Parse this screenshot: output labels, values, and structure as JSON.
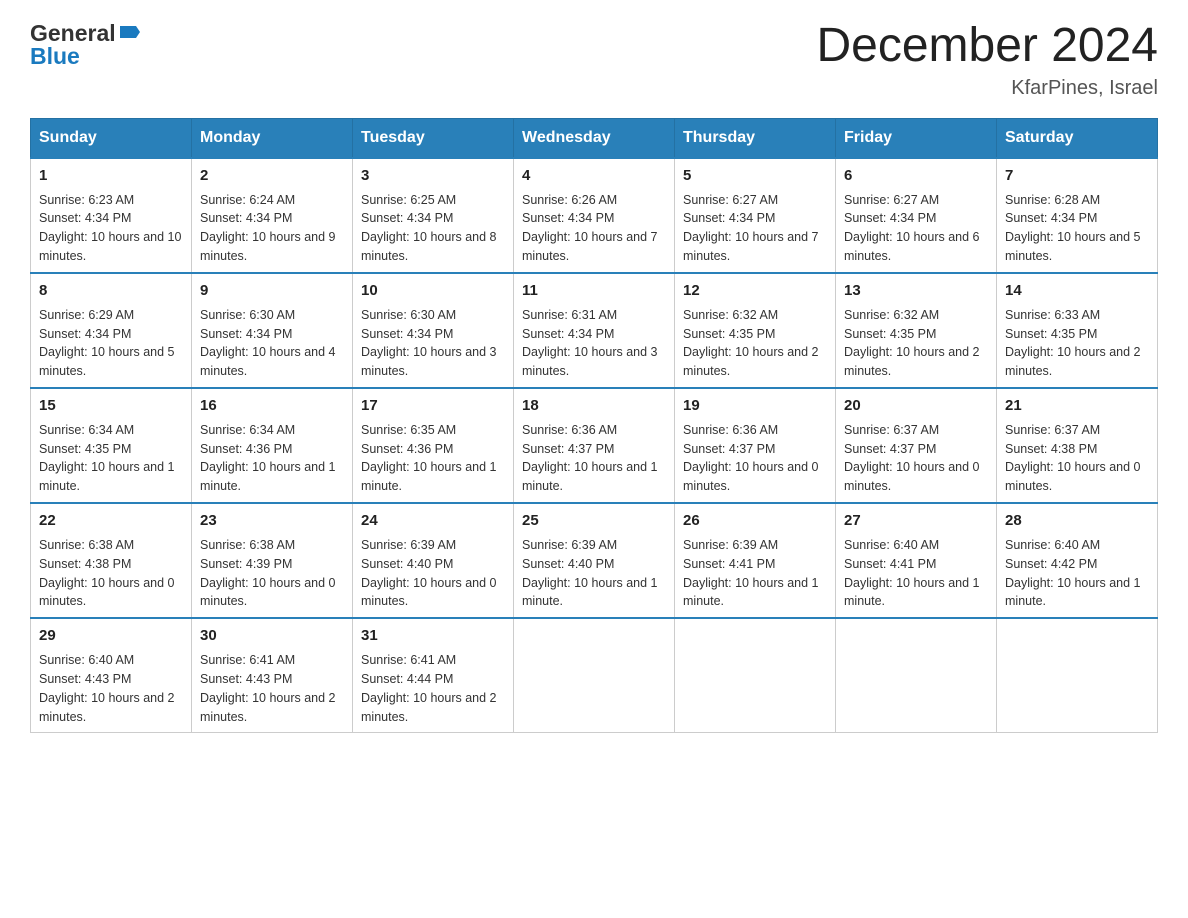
{
  "header": {
    "logo_general": "General",
    "logo_blue": "Blue",
    "title": "December 2024",
    "subtitle": "KfarPines, Israel"
  },
  "days_of_week": [
    "Sunday",
    "Monday",
    "Tuesday",
    "Wednesday",
    "Thursday",
    "Friday",
    "Saturday"
  ],
  "weeks": [
    [
      {
        "day": "1",
        "sunrise": "6:23 AM",
        "sunset": "4:34 PM",
        "daylight": "10 hours and 10 minutes."
      },
      {
        "day": "2",
        "sunrise": "6:24 AM",
        "sunset": "4:34 PM",
        "daylight": "10 hours and 9 minutes."
      },
      {
        "day": "3",
        "sunrise": "6:25 AM",
        "sunset": "4:34 PM",
        "daylight": "10 hours and 8 minutes."
      },
      {
        "day": "4",
        "sunrise": "6:26 AM",
        "sunset": "4:34 PM",
        "daylight": "10 hours and 7 minutes."
      },
      {
        "day": "5",
        "sunrise": "6:27 AM",
        "sunset": "4:34 PM",
        "daylight": "10 hours and 7 minutes."
      },
      {
        "day": "6",
        "sunrise": "6:27 AM",
        "sunset": "4:34 PM",
        "daylight": "10 hours and 6 minutes."
      },
      {
        "day": "7",
        "sunrise": "6:28 AM",
        "sunset": "4:34 PM",
        "daylight": "10 hours and 5 minutes."
      }
    ],
    [
      {
        "day": "8",
        "sunrise": "6:29 AM",
        "sunset": "4:34 PM",
        "daylight": "10 hours and 5 minutes."
      },
      {
        "day": "9",
        "sunrise": "6:30 AM",
        "sunset": "4:34 PM",
        "daylight": "10 hours and 4 minutes."
      },
      {
        "day": "10",
        "sunrise": "6:30 AM",
        "sunset": "4:34 PM",
        "daylight": "10 hours and 3 minutes."
      },
      {
        "day": "11",
        "sunrise": "6:31 AM",
        "sunset": "4:34 PM",
        "daylight": "10 hours and 3 minutes."
      },
      {
        "day": "12",
        "sunrise": "6:32 AM",
        "sunset": "4:35 PM",
        "daylight": "10 hours and 2 minutes."
      },
      {
        "day": "13",
        "sunrise": "6:32 AM",
        "sunset": "4:35 PM",
        "daylight": "10 hours and 2 minutes."
      },
      {
        "day": "14",
        "sunrise": "6:33 AM",
        "sunset": "4:35 PM",
        "daylight": "10 hours and 2 minutes."
      }
    ],
    [
      {
        "day": "15",
        "sunrise": "6:34 AM",
        "sunset": "4:35 PM",
        "daylight": "10 hours and 1 minute."
      },
      {
        "day": "16",
        "sunrise": "6:34 AM",
        "sunset": "4:36 PM",
        "daylight": "10 hours and 1 minute."
      },
      {
        "day": "17",
        "sunrise": "6:35 AM",
        "sunset": "4:36 PM",
        "daylight": "10 hours and 1 minute."
      },
      {
        "day": "18",
        "sunrise": "6:36 AM",
        "sunset": "4:37 PM",
        "daylight": "10 hours and 1 minute."
      },
      {
        "day": "19",
        "sunrise": "6:36 AM",
        "sunset": "4:37 PM",
        "daylight": "10 hours and 0 minutes."
      },
      {
        "day": "20",
        "sunrise": "6:37 AM",
        "sunset": "4:37 PM",
        "daylight": "10 hours and 0 minutes."
      },
      {
        "day": "21",
        "sunrise": "6:37 AM",
        "sunset": "4:38 PM",
        "daylight": "10 hours and 0 minutes."
      }
    ],
    [
      {
        "day": "22",
        "sunrise": "6:38 AM",
        "sunset": "4:38 PM",
        "daylight": "10 hours and 0 minutes."
      },
      {
        "day": "23",
        "sunrise": "6:38 AM",
        "sunset": "4:39 PM",
        "daylight": "10 hours and 0 minutes."
      },
      {
        "day": "24",
        "sunrise": "6:39 AM",
        "sunset": "4:40 PM",
        "daylight": "10 hours and 0 minutes."
      },
      {
        "day": "25",
        "sunrise": "6:39 AM",
        "sunset": "4:40 PM",
        "daylight": "10 hours and 1 minute."
      },
      {
        "day": "26",
        "sunrise": "6:39 AM",
        "sunset": "4:41 PM",
        "daylight": "10 hours and 1 minute."
      },
      {
        "day": "27",
        "sunrise": "6:40 AM",
        "sunset": "4:41 PM",
        "daylight": "10 hours and 1 minute."
      },
      {
        "day": "28",
        "sunrise": "6:40 AM",
        "sunset": "4:42 PM",
        "daylight": "10 hours and 1 minute."
      }
    ],
    [
      {
        "day": "29",
        "sunrise": "6:40 AM",
        "sunset": "4:43 PM",
        "daylight": "10 hours and 2 minutes."
      },
      {
        "day": "30",
        "sunrise": "6:41 AM",
        "sunset": "4:43 PM",
        "daylight": "10 hours and 2 minutes."
      },
      {
        "day": "31",
        "sunrise": "6:41 AM",
        "sunset": "4:44 PM",
        "daylight": "10 hours and 2 minutes."
      },
      null,
      null,
      null,
      null
    ]
  ]
}
